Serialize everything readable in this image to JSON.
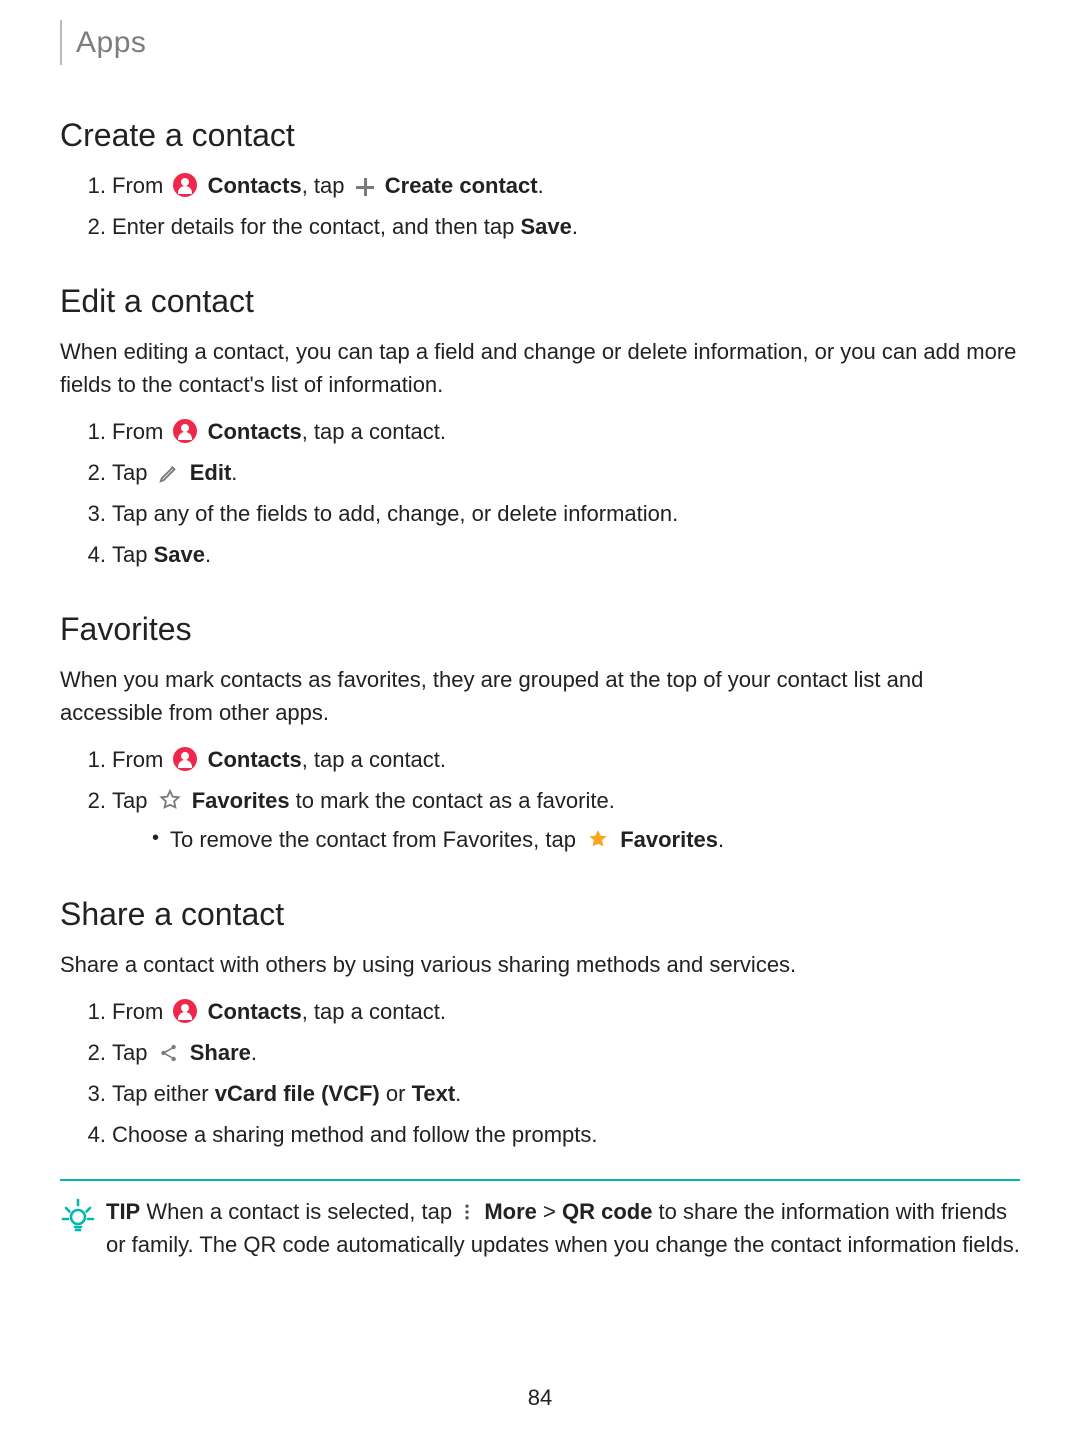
{
  "breadcrumb": "Apps",
  "page_number": "84",
  "sections": {
    "create": {
      "title": "Create a contact",
      "step1_from": "From",
      "step1_contacts": "Contacts",
      "step1_tap": ", tap",
      "step1_createcontact": "Create contact",
      "step1_period": ".",
      "step2_a": "Enter details for the contact, and then tap ",
      "step2_save": "Save",
      "step2_b": "."
    },
    "edit": {
      "title": "Edit a contact",
      "intro": "When editing a contact, you can tap a field and change or delete information, or you can add more fields to the contact's list of information.",
      "s1_from": "From",
      "s1_contacts": "Contacts",
      "s1_rest": ", tap a contact.",
      "s2_tap": "Tap",
      "s2_edit": "Edit",
      "s2_period": ".",
      "s3": "Tap any of the fields to add, change, or delete information.",
      "s4_a": "Tap ",
      "s4_save": "Save",
      "s4_b": "."
    },
    "fav": {
      "title": "Favorites",
      "intro": "When you mark contacts as favorites, they are grouped at the top of your contact list and accessible from other apps.",
      "s1_from": "From",
      "s1_contacts": "Contacts",
      "s1_rest": ", tap a contact.",
      "s2_tap": "Tap",
      "s2_fav": "Favorites",
      "s2_rest": " to mark the contact as a favorite.",
      "sub_a": "To remove the contact from Favorites, tap",
      "sub_fav": "Favorites",
      "sub_b": "."
    },
    "share": {
      "title": "Share a contact",
      "intro": "Share a contact with others by using various sharing methods and services.",
      "s1_from": "From",
      "s1_contacts": "Contacts",
      "s1_rest": ", tap a contact.",
      "s2_tap": "Tap",
      "s2_share": "Share",
      "s2_period": ".",
      "s3_a": "Tap either ",
      "s3_vcf": "vCard file (VCF)",
      "s3_or": " or ",
      "s3_text": "Text",
      "s3_b": ".",
      "s4": "Choose a sharing method and follow the prompts."
    },
    "tip": {
      "label": "TIP",
      "a": "  When a contact is selected, tap",
      "more": "More",
      "gt": " > ",
      "qr": "QR code",
      "b": " to share the information with friends or family. The QR code automatically updates when you change the contact information fields."
    }
  }
}
